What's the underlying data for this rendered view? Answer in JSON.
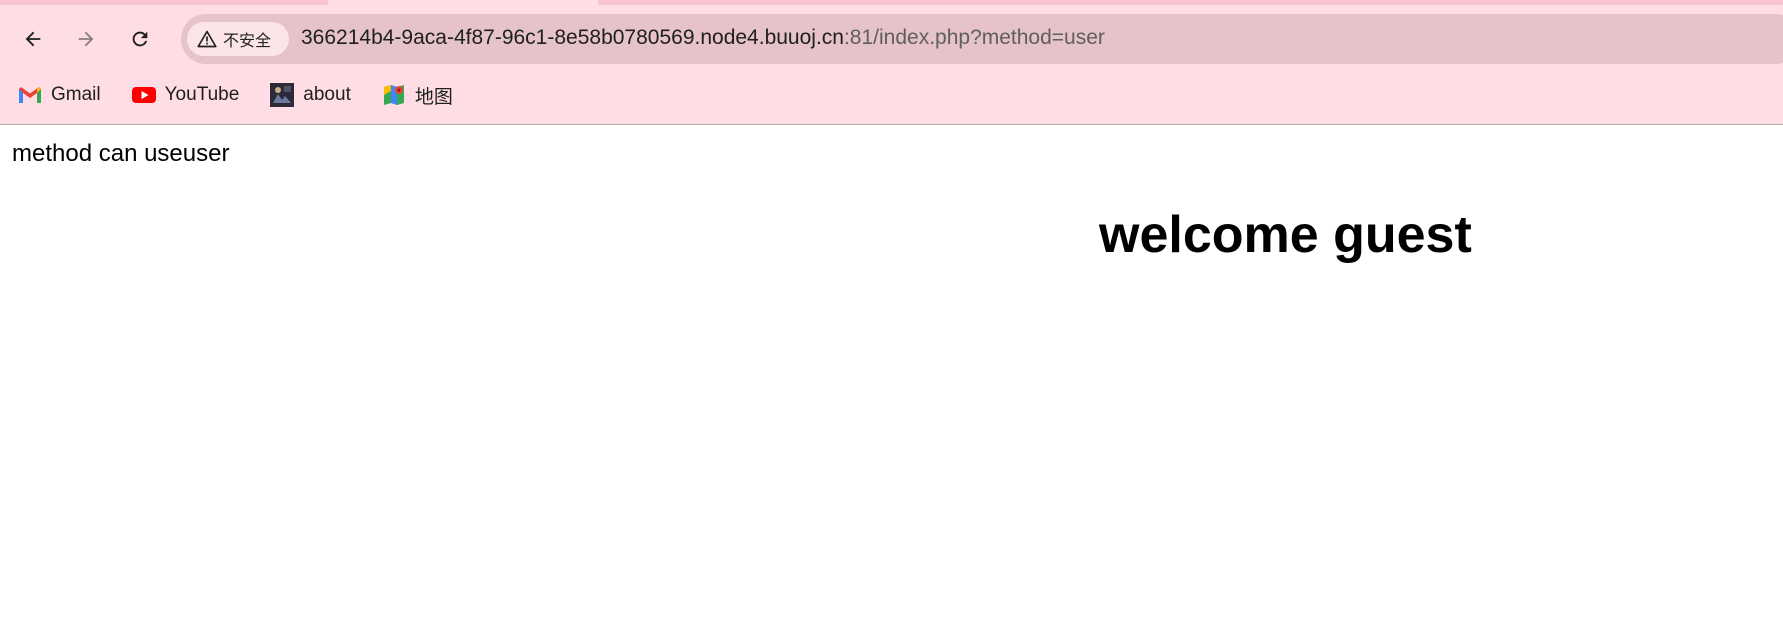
{
  "browser": {
    "nav": {
      "back_icon": "arrow-left-icon",
      "forward_icon": "arrow-right-icon",
      "reload_icon": "reload-icon"
    },
    "address_bar": {
      "security_label": "不安全",
      "security_icon": "warning-triangle-icon",
      "url_host": "366214b4-9aca-4f87-96c1-8e58b0780569.node4.buuoj.cn",
      "url_rest": ":81/index.php?method=user"
    },
    "bookmarks": [
      {
        "label": "Gmail",
        "icon": "gmail-icon"
      },
      {
        "label": "YouTube",
        "icon": "youtube-icon"
      },
      {
        "label": "about",
        "icon": "about-thumbnail-icon"
      },
      {
        "label": "地图",
        "icon": "maps-icon"
      }
    ],
    "colors": {
      "chrome_bg": "#fedde4",
      "omnibox_bg": "#e5c3c9",
      "youtube_red": "#ff0000"
    }
  },
  "page": {
    "message": "method can useuser",
    "heading": "welcome guest"
  }
}
